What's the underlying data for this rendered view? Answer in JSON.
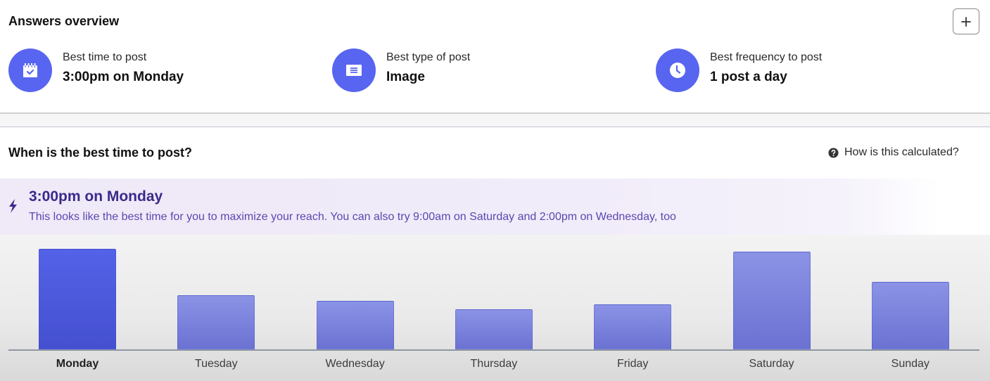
{
  "overview": {
    "title": "Answers overview",
    "add_button_icon": "plus-icon",
    "answers": [
      {
        "icon": "calendar-check-icon",
        "label": "Best time to post",
        "value": "3:00pm on Monday"
      },
      {
        "icon": "post-list-icon",
        "label": "Best type of post",
        "value": "Image"
      },
      {
        "icon": "clock-icon",
        "label": "Best frequency to post",
        "value": "1 post a day"
      }
    ],
    "accent_color": "#5865f0"
  },
  "best_time": {
    "title": "When is the best time to post?",
    "help_link": "How is this calculated?",
    "help_icon": "question-circle-icon",
    "banner": {
      "icon": "lightning-bolt-icon",
      "headline": "3:00pm on Monday",
      "description": "This looks like the best time for you to maximize your reach. You can also try 9:00am on Saturday and 2:00pm on Wednesday, too"
    }
  },
  "chart_data": {
    "type": "bar",
    "title": "",
    "xlabel": "",
    "ylabel": "",
    "categories": [
      "Monday",
      "Tuesday",
      "Wednesday",
      "Thursday",
      "Friday",
      "Saturday",
      "Sunday"
    ],
    "values": [
      100,
      54,
      48,
      40,
      45,
      97,
      67
    ],
    "highlight": "Monday",
    "ylim": [
      0,
      100
    ],
    "grid": false,
    "colors": {
      "highlight": "#4c59e0",
      "normal": "#7c83dc"
    }
  }
}
